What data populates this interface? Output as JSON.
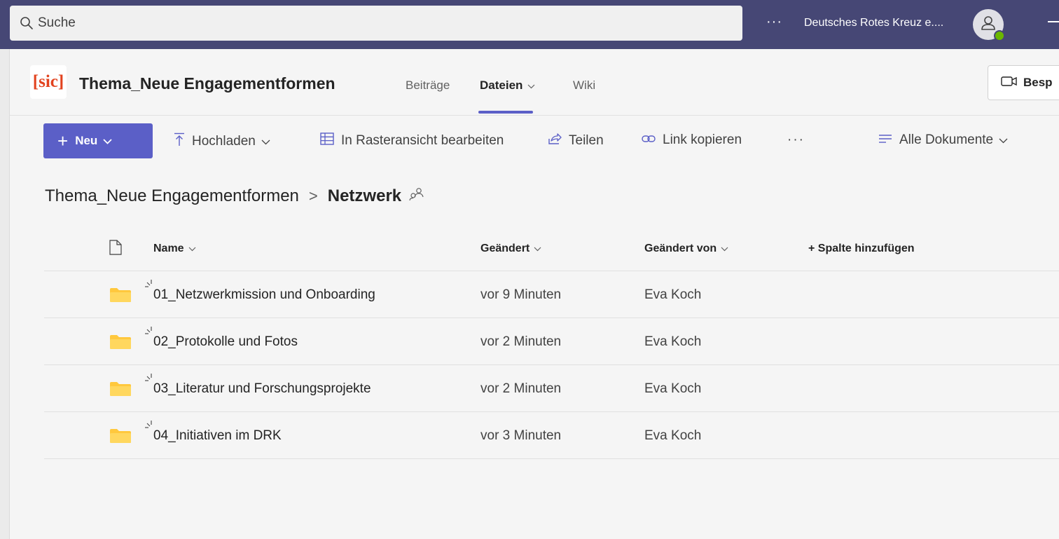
{
  "topbar": {
    "search_placeholder": "Suche",
    "more_label": "···",
    "org_name": "Deutsches Rotes Kreuz e....",
    "avatar_icon": "person-icon",
    "presence_color": "#6bb700",
    "bar_color": "#464775"
  },
  "channel": {
    "logo_text": "[sic]",
    "title": "Thema_Neue Engagementformen",
    "tabs": [
      {
        "label": "Beiträge",
        "active": false
      },
      {
        "label": "Dateien",
        "active": true
      },
      {
        "label": "Wiki",
        "active": false
      }
    ],
    "meet_label": "Besp"
  },
  "toolbar": {
    "new_label": "Neu",
    "upload_label": "Hochladen",
    "grid_edit_label": "In Rasteransicht bearbeiten",
    "share_label": "Teilen",
    "copy_link_label": "Link kopieren",
    "more_label": "···",
    "view_label": "Alle Dokumente",
    "accent_color": "#5b5fc7"
  },
  "breadcrumb": {
    "parent": "Thema_Neue Engagementformen",
    "separator": ">",
    "current": "Netzwerk"
  },
  "table": {
    "columns": {
      "name": "Name",
      "modified": "Geändert",
      "modified_by": "Geändert von",
      "add_column": "+ Spalte hinzufügen"
    },
    "rows": [
      {
        "name": "01_Netzwerkmission und Onboarding",
        "modified": "vor 9 Minuten",
        "modified_by": "Eva Koch"
      },
      {
        "name": "02_Protokolle und Fotos",
        "modified": "vor 2 Minuten",
        "modified_by": "Eva Koch"
      },
      {
        "name": "03_Literatur und Forschungsprojekte",
        "modified": "vor 2 Minuten",
        "modified_by": "Eva Koch"
      },
      {
        "name": "04_Initiativen im DRK",
        "modified": "vor 3 Minuten",
        "modified_by": "Eva Koch"
      }
    ],
    "folder_color": "#ffc83d"
  }
}
